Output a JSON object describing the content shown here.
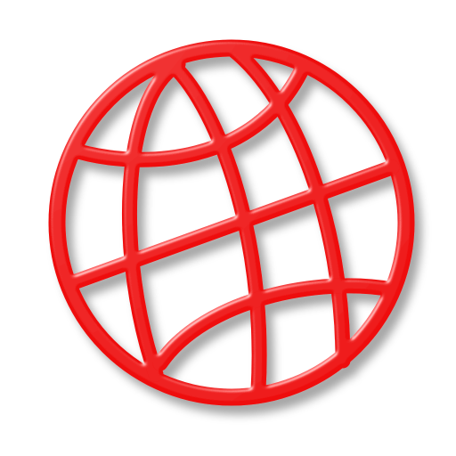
{
  "icon": {
    "name": "globe-icon",
    "style": "embossed-outline",
    "colors": {
      "stroke": "#ee0a0a",
      "stroke_dark": "#b30000",
      "highlight": "#ff8a8a",
      "background": "#ffffff"
    }
  }
}
